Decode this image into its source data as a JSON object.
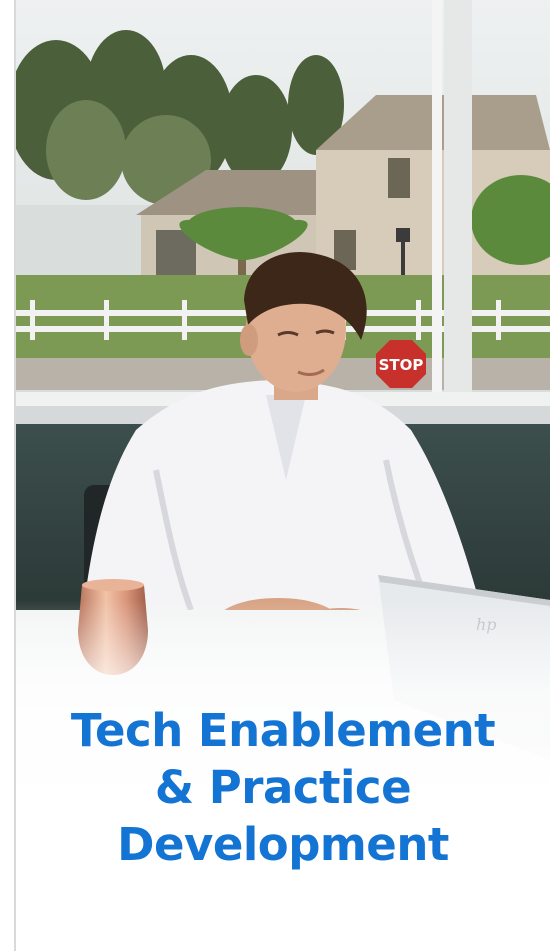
{
  "hero": {
    "image": "office-photo-young-man-at-desk-with-laptop",
    "stop_sign_text": "STOP",
    "laptop_logo": "hp"
  },
  "headline": {
    "lines": [
      "Tech Enablement",
      "& Practice",
      "Development"
    ]
  },
  "colors": {
    "headline": "#1474d4",
    "background": "#ffffff",
    "frame_rule": "#d9d9d9"
  }
}
